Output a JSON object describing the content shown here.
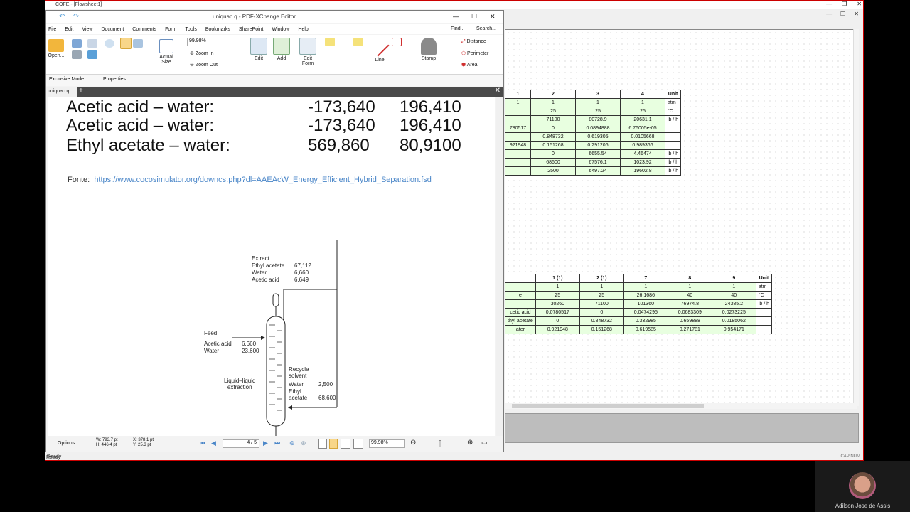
{
  "cofe": {
    "title": "COFE - [Flowsheet1]",
    "status": "Ready",
    "capnum": "CAP NUM",
    "table1": {
      "headers": [
        "1",
        "2",
        "3",
        "4",
        "Unit"
      ],
      "rows": [
        [
          "1",
          "1",
          "1",
          "1",
          "atm"
        ],
        [
          "",
          "25",
          "25",
          "25",
          "°C"
        ],
        [
          "",
          "71100",
          "80728.9",
          "20631.1",
          "lb / h"
        ],
        [
          "780517",
          "0",
          "0.0894888",
          "6.76005e-05",
          ""
        ],
        [
          "",
          "0.848732",
          "0.619305",
          "0.0105668",
          ""
        ],
        [
          "921948",
          "0.151268",
          "0.291206",
          "0.989366",
          ""
        ],
        [
          "",
          "0",
          "6655.54",
          "4.46474",
          "lb / h"
        ],
        [
          "",
          "68600",
          "67576.1",
          "1023.92",
          "lb / h"
        ],
        [
          "",
          "2500",
          "6497.24",
          "19602.8",
          "lb / h"
        ]
      ]
    },
    "table2": {
      "headers": [
        "",
        "1 (1)",
        "2 (1)",
        "7",
        "8",
        "9",
        "Unit"
      ],
      "rows": [
        [
          "",
          "1",
          "1",
          "1",
          "1",
          "1",
          "atm"
        ],
        [
          "e",
          "25",
          "25",
          "26.1686",
          "40",
          "40",
          "°C"
        ],
        [
          "",
          "30260",
          "71100",
          "101360",
          "76974.8",
          "24385.2",
          "lb / h"
        ],
        [
          "cetic acid",
          "0.0780517",
          "0",
          "0.0474295",
          "0.0683309",
          "0.0273225",
          ""
        ],
        [
          "thyl acetate",
          "0",
          "0.848732",
          "0.332985",
          "0.659888",
          "0.0185062",
          ""
        ],
        [
          "ater",
          "0.921948",
          "0.151268",
          "0.619585",
          "0.271781",
          "0.954171",
          ""
        ]
      ]
    }
  },
  "pdf": {
    "title": "uniquac q - PDF-XChange Editor",
    "menu": [
      "File",
      "Edit",
      "View",
      "Document",
      "Comments",
      "Form",
      "Tools",
      "Bookmarks",
      "SharePoint",
      "Window",
      "Help"
    ],
    "find": "Find...",
    "search": "Search...",
    "zoom_value": "99.98%",
    "zoom_in": "Zoom In",
    "zoom_out": "Zoom Out",
    "actual_size": "Actual Size",
    "open": "Open...",
    "edit": "Edit",
    "add": "Add",
    "edit_form": "Edit Form",
    "line": "Line",
    "stamp": "Stamp",
    "distance": "Distance",
    "perimeter": "Perimeter",
    "area": "Area",
    "exclusive_mode": "Exclusive Mode",
    "properties": "Properties...",
    "tab": "uniquac q",
    "options": "Options...",
    "dims": "W: 793.7 pt\nH: 446.4 pt",
    "coords": "X: 378.1 pt\nY: 25.3 pt",
    "page_indicator": "4 / 5",
    "zoom_bottom": "99.98%",
    "status": "Ready"
  },
  "doc": {
    "pairs": [
      {
        "name": "Acetic acid – water:",
        "a": "-173,640",
        "b": "196,410"
      },
      {
        "name": "Acetic acid – water:",
        "a": "-173,640",
        "b": "196,410"
      },
      {
        "name": "Ethyl acetate – water:",
        "a": "569,860",
        "b": "80,9100"
      }
    ],
    "fonte_label": "Fonte:",
    "fonte_url": "https://www.cocosimulator.org/downcs.php?dl=AAEAcW_Energy_Efficient_Hybrid_Separation.fsd",
    "diagram": {
      "extract": "Extract",
      "extract_rows": [
        [
          "Ethyl acetate",
          "67,112"
        ],
        [
          "Water",
          "6,660"
        ],
        [
          "Acetic acid",
          "6,649"
        ]
      ],
      "feed": "Feed",
      "feed_rows": [
        [
          "Acetic acid",
          "6,660"
        ],
        [
          "Water",
          "23,600"
        ]
      ],
      "lle": "Liquid–liquid\nextraction",
      "recycle": "Recycle\nsolvent",
      "recycle_rows": [
        [
          "Water",
          "2,500"
        ],
        [
          "Ethyl\nacetate",
          "68,600"
        ]
      ]
    }
  },
  "webcam": {
    "name": "Adilson Jose de Assis"
  }
}
